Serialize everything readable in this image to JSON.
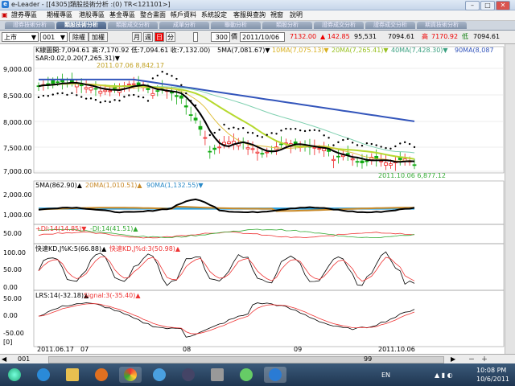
{
  "window": {
    "title": "e-Leader - [[4305]類股技術分析 :(0) TR<121101>]",
    "min": "–",
    "max": "□",
    "close": "✕"
  },
  "menu": [
    "證券專區",
    "期權專區",
    "港股專區",
    "基金專區",
    "整合畫面",
    "帳戶資料",
    "系統設定",
    "客服與查詢",
    "視窗",
    "說明"
  ],
  "tabs": [
    {
      "label": "證券技術分析",
      "active": false
    },
    {
      "label": "類股技術分析",
      "active": true
    },
    {
      "label": "類股成交分析",
      "active": false
    },
    {
      "label": "成單分析",
      "active": false
    },
    {
      "label": "聯動分析",
      "active": false
    },
    {
      "label": "類股分析",
      "active": false
    },
    {
      "label": "證券成交分析",
      "active": false
    },
    {
      "label": "證券成交分析",
      "active": false
    },
    {
      "label": "期貨技術分析",
      "active": false
    }
  ],
  "toolbar": {
    "market": "上市",
    "code": "001",
    "restore_label": "除權",
    "adjust_label": "加權",
    "period_month": "月",
    "period_week": "週",
    "period_day": "日",
    "period_minute": "分",
    "count": "300",
    "unit_label": "價",
    "date": "2011/10/06",
    "last_price": "7132.00",
    "change": "▲ 142.85",
    "volume": "95,531",
    "open": "7094.61",
    "high_label": "高",
    "high": "7170.92",
    "low_label": "低",
    "low": "7094.61"
  },
  "panels": {
    "k_label": "K線圖開:7,094.61 高:7,170.92 低:7,094.61 收:7,132.00)",
    "ma5": "5MA(7,081.67)▼",
    "ma10": "10MA(7,075.13)▼",
    "ma20": "20MA(7,265.41)▼",
    "ma40": "40MA(7,428.30)▼",
    "ma90": "90MA(8,087",
    "sar": "SAR:0.02,0.20(7,265.31)▼",
    "high_annot": "2011.07.06  8,842.17",
    "low_annot": "2011.10.06  6,877.12",
    "vol_ma5": "5MA(862.90)▲",
    "vol_ma20": "20MA(1,010.51)▲",
    "vol_ma90": "90MA(1,132.55)▼",
    "dmi_plus": "+DI:14(14.85)▼",
    "dmi_minus": "-DI:14(41.51)▲",
    "kd_k": "快速KD,J%K:5(66.88)▲",
    "kd_d": "快速KD,J%d:3(50.98)▲",
    "lrs": "LRS:14(-32.18)▲",
    "signal": "Signal:3(-35.40)▲",
    "price_ticks": [
      "9,000.00",
      "8,500.00",
      "8,000.00",
      "7,500.00",
      "7,000.00"
    ],
    "vol_ticks": [
      "2,000.00",
      "1,000.00",
      "0.00"
    ],
    "dmi_ticks": [
      "50.00",
      "0.00"
    ],
    "kd_ticks": [
      "100.00",
      "50.00",
      "0.00"
    ],
    "lrs_ticks": [
      "50.00",
      "0.00",
      "-50.00"
    ],
    "zero_label": "[0]",
    "dates": [
      "2011.06.17",
      "07",
      "08",
      "09",
      "2011.10.06"
    ]
  },
  "bottom": {
    "code": "001",
    "page": "99"
  },
  "tray": {
    "lang": "EN",
    "time": "10:08 PM",
    "date": "10/6/2011"
  }
}
